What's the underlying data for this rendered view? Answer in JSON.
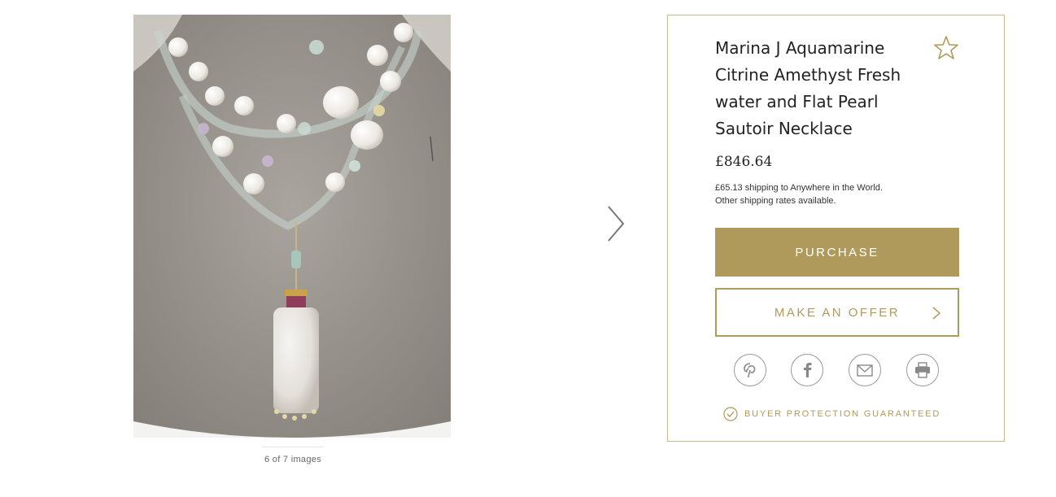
{
  "gallery": {
    "counter_text": "6 of 7 images"
  },
  "product": {
    "title": "Marina J Aquamarine Citrine Amethyst Fresh water and Flat Pearl Sautoir Necklace",
    "price": "£846.64",
    "shipping_line1": "£65.13 shipping to Anywhere in the World.",
    "shipping_line2": "Other shipping rates available."
  },
  "actions": {
    "purchase_label": "PURCHASE",
    "offer_label": "MAKE AN OFFER",
    "protection_label": "BUYER PROTECTION GUARANTEED"
  },
  "share": {
    "icons": [
      "pinterest-icon",
      "facebook-icon",
      "email-icon",
      "print-icon"
    ]
  },
  "colors": {
    "accent": "#b09a5b",
    "panel_border": "#c9b98e"
  }
}
